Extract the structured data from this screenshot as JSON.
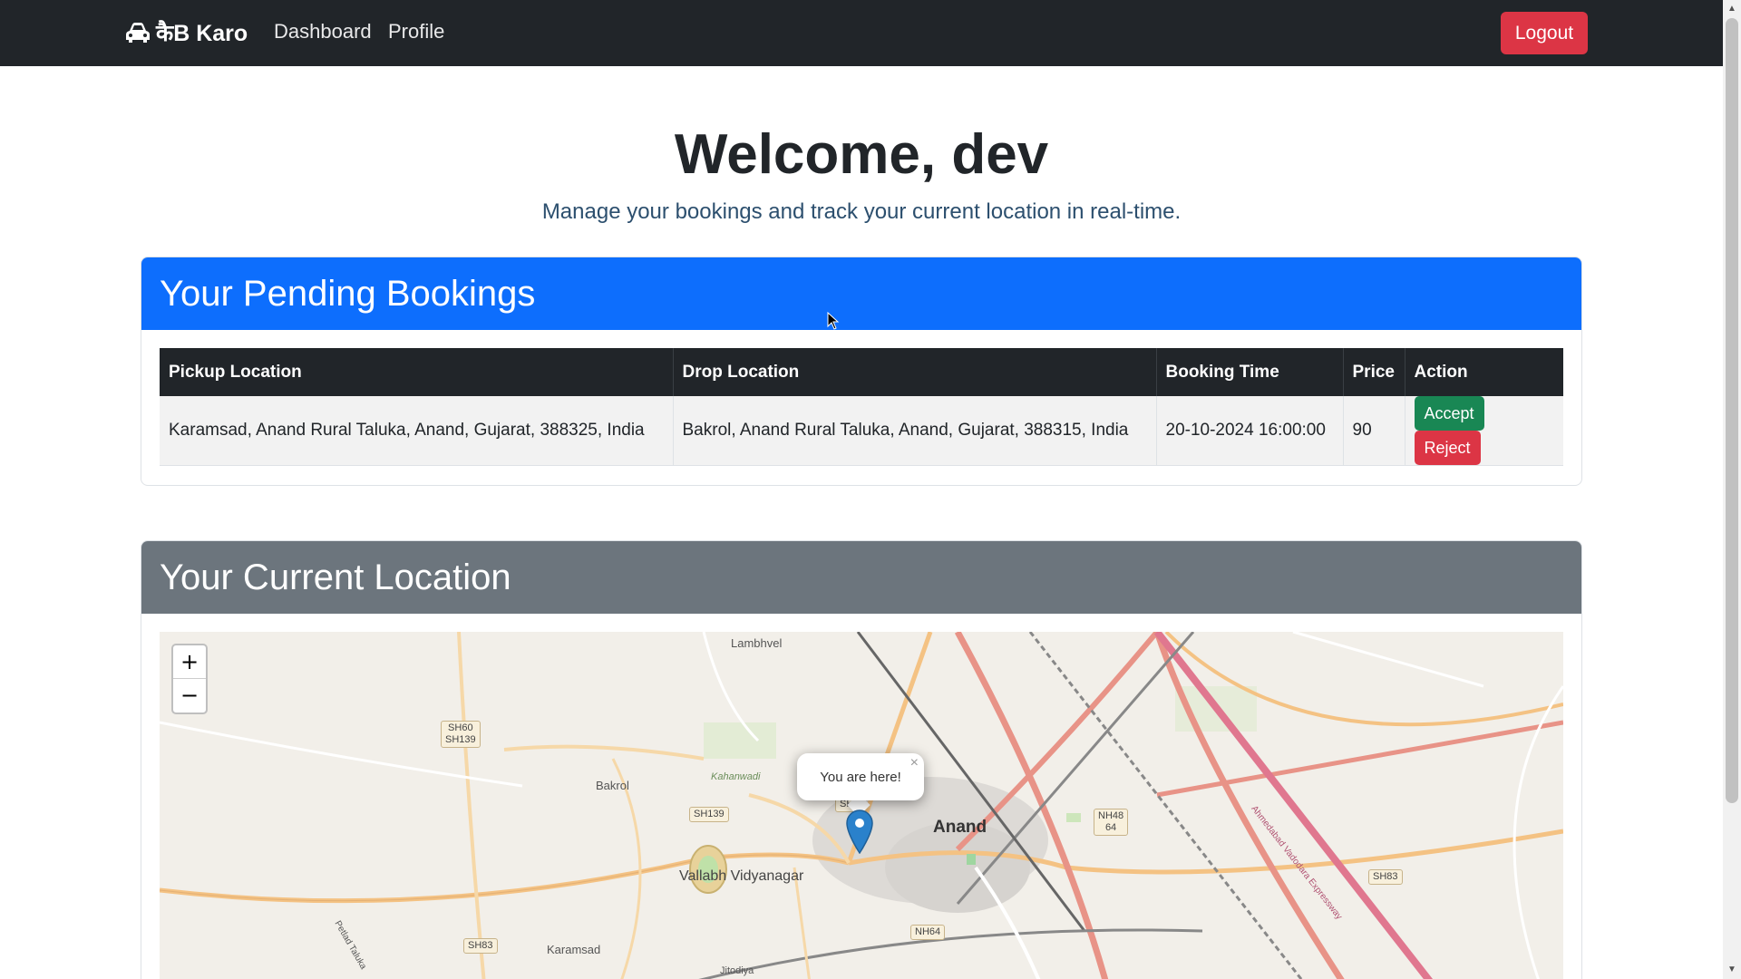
{
  "navbar": {
    "brand": "कैB Karo",
    "links": [
      "Dashboard",
      "Profile"
    ],
    "logout": "Logout"
  },
  "hero": {
    "title": "Welcome, dev",
    "subtitle": "Manage your bookings and track your current location in real-time."
  },
  "bookings": {
    "header": "Your Pending Bookings",
    "columns": [
      "Pickup Location",
      "Drop Location",
      "Booking Time",
      "Price",
      "Action"
    ],
    "rows": [
      {
        "pickup": "Karamsad, Anand Rural Taluka, Anand, Gujarat, 388325, India",
        "drop": "Bakrol, Anand Rural Taluka, Anand, Gujarat, 388315, India",
        "time": "20-10-2024 16:00:00",
        "price": "90",
        "accept_label": "Accept",
        "reject_label": "Reject"
      }
    ]
  },
  "location": {
    "header": "Your Current Location",
    "zoom_in": "+",
    "zoom_out": "−",
    "popup_text": "You are here!",
    "popup_close": "×",
    "map_labels": {
      "lambhvel": "Lambhvel",
      "bakrol": "Bakrol",
      "kaharvadi": "Kahanwadi",
      "vallabh": "Vallabh Vidyanagar",
      "anand": "Anand",
      "karamsad": "Karamsad",
      "jitodiya": "Jitodiya",
      "expressway": "Ahmedabad Vadodara Expressway",
      "taluka": "Petlad Taluka"
    },
    "road_badges": {
      "sh60": "SH60\nSH139",
      "sh139": "SH139",
      "sh83a": "SH83",
      "sh83b": "SH83",
      "nh48": "NH48\n64",
      "nh64": "NH64",
      "sh": "SH"
    }
  },
  "colors": {
    "navbar": "#212529",
    "primary": "#0d6efd",
    "secondary": "#6c757d",
    "danger": "#dc3545",
    "success": "#198754"
  }
}
